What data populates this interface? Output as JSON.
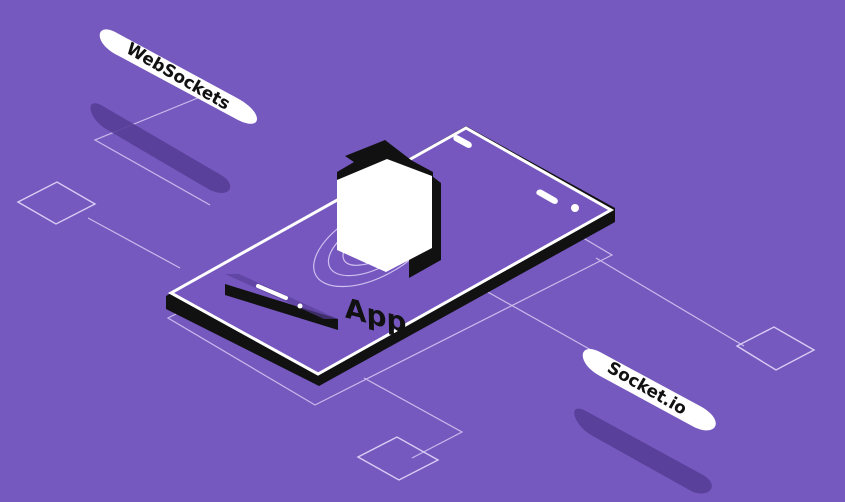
{
  "illustration": {
    "app_label": "App",
    "pill_left_label": "WebSockets",
    "pill_right_label": "Socket.io"
  },
  "colors": {
    "background": "#7559BE",
    "line": "#D9CCF5",
    "shadow": "#573D97",
    "device_body": "#111111",
    "device_screen": "#7657BF",
    "white": "#FFFFFF"
  },
  "icons": {
    "device": "smartphone-icon",
    "app_tile": "app-tile-icon",
    "signal": "signal-rings-icon",
    "nodes": "square-node-icon"
  }
}
